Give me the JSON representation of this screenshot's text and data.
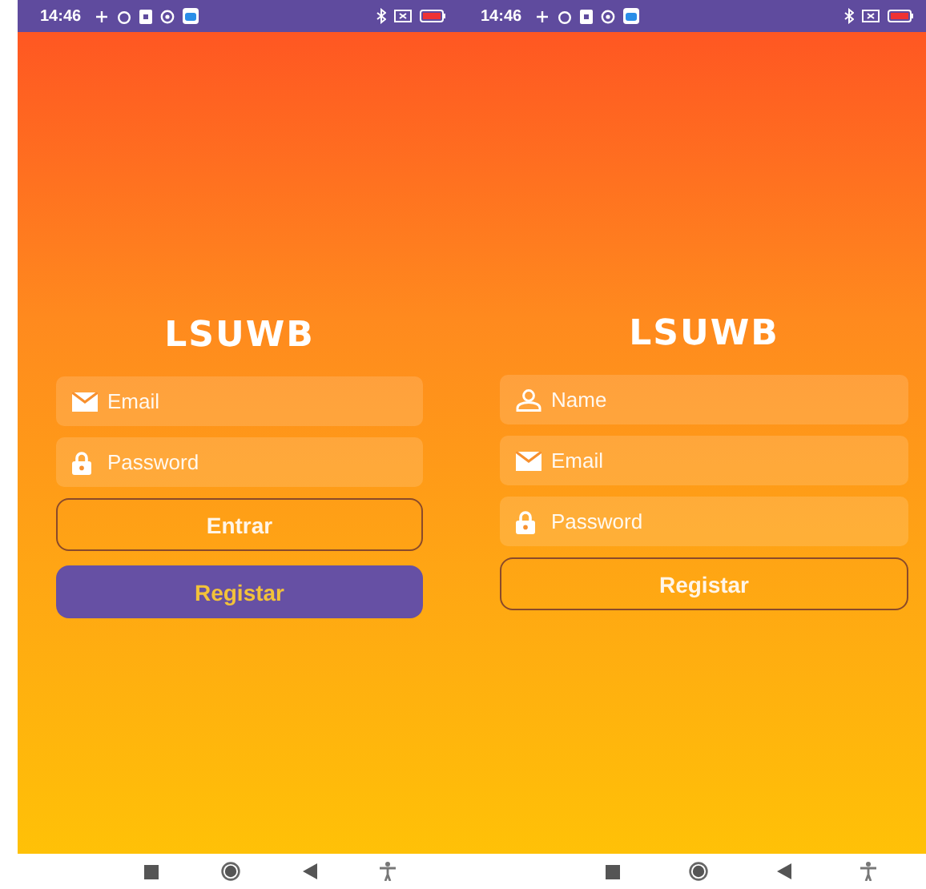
{
  "screens": [
    {
      "status_bar": {
        "time": "14:46"
      },
      "logo": "LSUWB",
      "fields": [
        {
          "kind": "email",
          "placeholder": "Email"
        },
        {
          "kind": "password",
          "placeholder": "Password"
        }
      ],
      "buttons": [
        {
          "kind": "outline",
          "label": "Entrar"
        },
        {
          "kind": "filled",
          "label": "Registar"
        }
      ]
    },
    {
      "status_bar": {
        "time": "14:46"
      },
      "logo": "LSUWB",
      "fields": [
        {
          "kind": "name",
          "placeholder": "Name"
        },
        {
          "kind": "email",
          "placeholder": "Email"
        },
        {
          "kind": "password",
          "placeholder": "Password"
        }
      ],
      "buttons": [
        {
          "kind": "outline",
          "label": "Registar"
        }
      ]
    }
  ]
}
